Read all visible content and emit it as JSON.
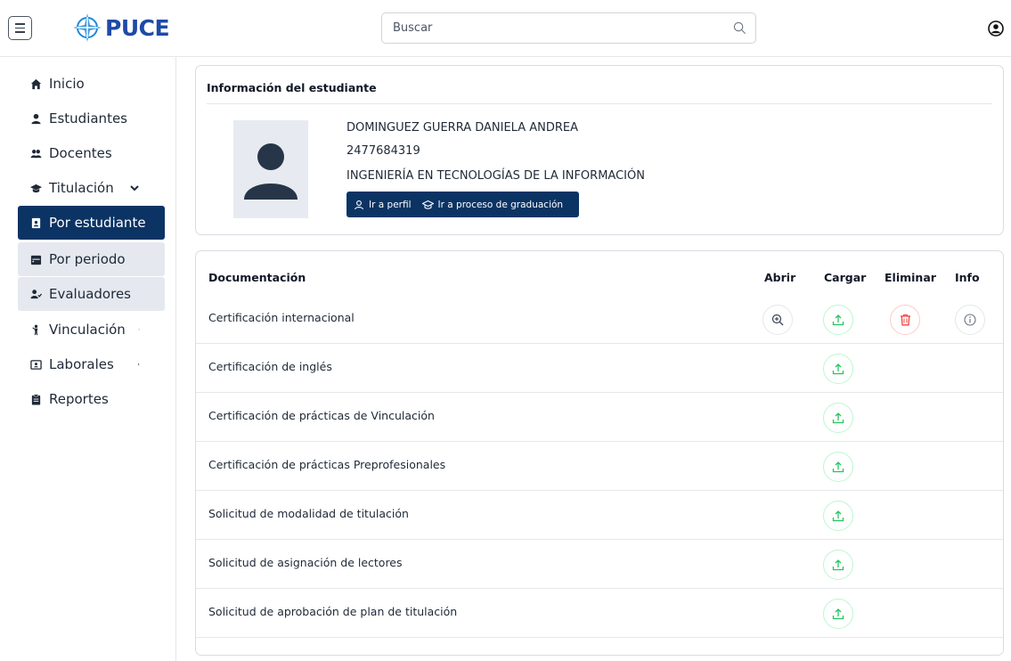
{
  "header": {
    "logo_text": "PUCE",
    "search_placeholder": "Buscar"
  },
  "sidebar": {
    "items": [
      {
        "label": "Inicio",
        "icon": "home-icon"
      },
      {
        "label": "Estudiantes",
        "icon": "user-icon"
      },
      {
        "label": "Docentes",
        "icon": "users-icon"
      },
      {
        "label": "Titulación",
        "icon": "graduation-cap-icon",
        "expanded": true
      },
      {
        "label": "Por estudiante",
        "icon": "id-badge-icon",
        "active": true
      },
      {
        "label": "Por periodo",
        "icon": "calendar-icon"
      },
      {
        "label": "Evaluadores",
        "icon": "user-check-icon"
      },
      {
        "label": "Vinculación",
        "icon": "handshake-icon"
      },
      {
        "label": "Laborales",
        "icon": "briefcase-icon"
      },
      {
        "label": "Reportes",
        "icon": "clipboard-icon"
      }
    ]
  },
  "student": {
    "card_title": "Información del estudiante",
    "name": "DOMINGUEZ GUERRA DANIELA ANDREA",
    "id_number": "2477684319",
    "program": "INGENIERÍA EN TECNOLOGÍAS DE LA INFORMACIÓN",
    "profile_link": "Ir a perfil",
    "graduation_link": "Ir a proceso de graduación"
  },
  "documents": {
    "headers": {
      "name": "Documentación",
      "open": "Abrir",
      "upload": "Cargar",
      "delete": "Eliminar",
      "info": "Info"
    },
    "rows": [
      {
        "label": "Certificación internacional",
        "uploaded": true
      },
      {
        "label": "Certificación de inglés",
        "uploaded": false
      },
      {
        "label": "Certificación de prácticas de Vinculación",
        "uploaded": false
      },
      {
        "label": "Certificación de prácticas Preprofesionales",
        "uploaded": false
      },
      {
        "label": "Solicitud de modalidad de titulación",
        "uploaded": false
      },
      {
        "label": "Solicitud de asignación de lectores",
        "uploaded": false
      },
      {
        "label": "Solicitud de aprobación de plan de titulación",
        "uploaded": false
      }
    ]
  },
  "colors": {
    "primary": "#0b3464",
    "upload": "#22c55e",
    "delete": "#ef4444",
    "brand": "#1e4aa8"
  }
}
